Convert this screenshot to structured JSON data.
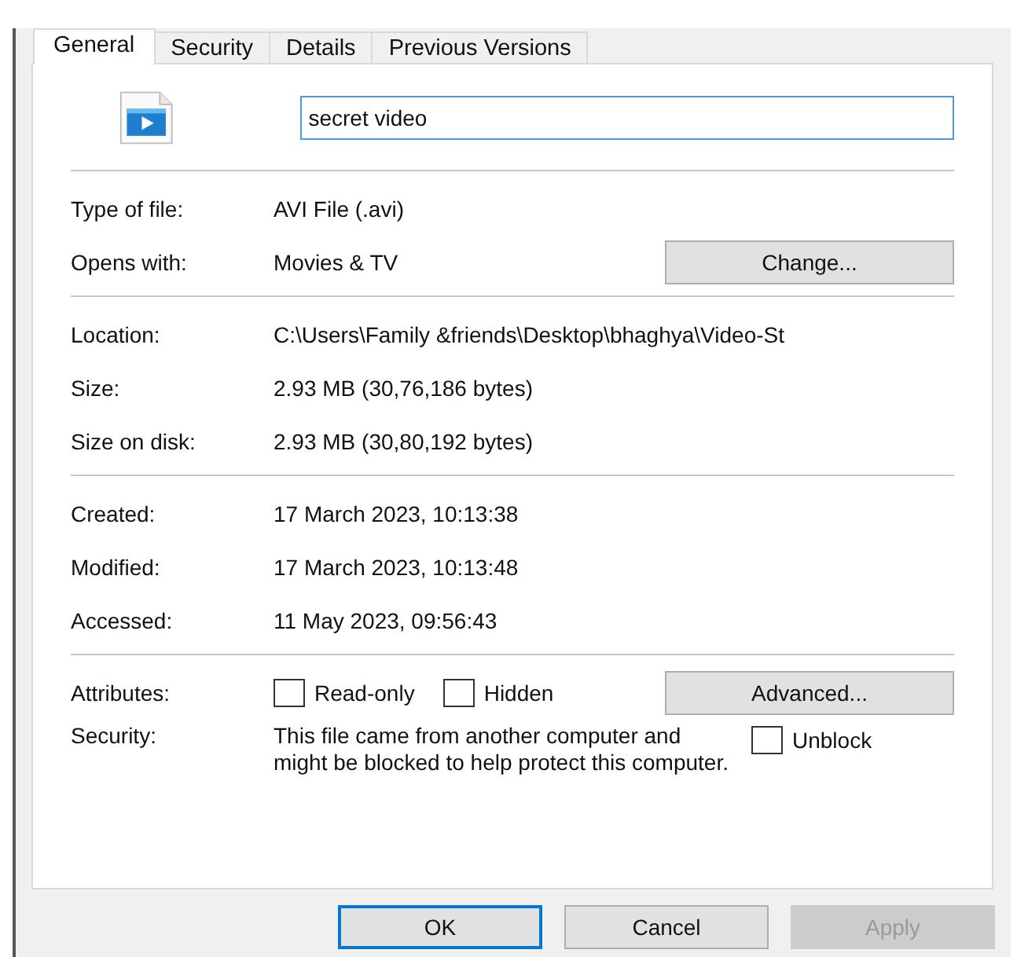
{
  "tabs": [
    {
      "label": "General",
      "selected": true
    },
    {
      "label": "Security",
      "selected": false
    },
    {
      "label": "Details",
      "selected": false
    },
    {
      "label": "Previous Versions",
      "selected": false
    }
  ],
  "file_name": {
    "value": "secret video"
  },
  "sections": [
    {
      "rows": [
        {
          "kind": "text",
          "label": "Type of file:",
          "value": "AVI File (.avi)"
        },
        {
          "kind": "button",
          "label": "Opens with:",
          "value": "Movies & TV",
          "button": "Change..."
        }
      ]
    },
    {
      "rows": [
        {
          "kind": "text",
          "label": "Location:",
          "value": "C:\\Users\\Family &friends\\Desktop\\bhaghya\\Video-St"
        },
        {
          "kind": "text",
          "label": "Size:",
          "value": "2.93 MB (30,76,186 bytes)"
        },
        {
          "kind": "text",
          "label": "Size on disk:",
          "value": "2.93 MB (30,80,192 bytes)"
        }
      ]
    },
    {
      "rows": [
        {
          "kind": "text",
          "label": "Created:",
          "value": "17 March 2023, 10:13:38"
        },
        {
          "kind": "text",
          "label": "Modified:",
          "value": "17 March 2023, 10:13:48"
        },
        {
          "kind": "text",
          "label": "Accessed:",
          "value": "11 May 2023, 09:56:43"
        }
      ]
    },
    {
      "rows": [
        {
          "kind": "attributes",
          "label": "Attributes:",
          "checkboxes": [
            {
              "label": "Read-only",
              "checked": false
            },
            {
              "label": "Hidden",
              "checked": false
            }
          ],
          "button": "Advanced..."
        },
        {
          "kind": "security",
          "label": "Security:",
          "value": "This file came from another computer and might be blocked to help protect this computer.",
          "checkbox": {
            "label": "Unblock",
            "checked": false
          }
        }
      ]
    }
  ],
  "buttons": [
    {
      "label": "OK",
      "default": true,
      "disabled": false
    },
    {
      "label": "Cancel",
      "default": false,
      "disabled": false
    },
    {
      "label": "Apply",
      "default": false,
      "disabled": true
    }
  ]
}
